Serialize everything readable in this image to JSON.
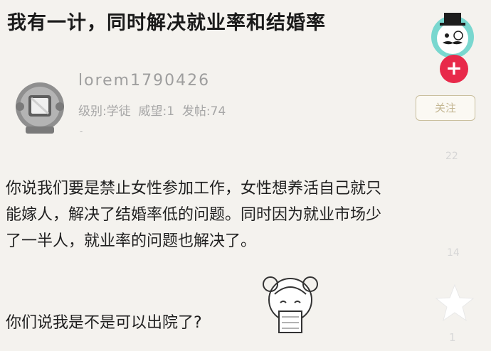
{
  "title": "我有一计，同时解决就业率和结婚率",
  "user": {
    "name": "lorem1790426",
    "level_label": "级别:学徒",
    "prestige_label": "威望:1",
    "posts_label": "发帖:74",
    "follow_label": "关注"
  },
  "post": {
    "line1": "你说我们要是禁止女性参加工作，女性想养活自己就只",
    "line2": "能嫁人，解决了结婚率低的问题。同时因为就业市场少",
    "line3": "了一半人，就业率的问题也解决了。",
    "question": "你们说我是不是可以出院了?"
  },
  "side": {
    "plus_label": "+",
    "count_1": "22",
    "count_2": "14",
    "star_count": "1"
  },
  "colors": {
    "plus": "#e8294a",
    "follow_border": "#c9bf9e"
  }
}
